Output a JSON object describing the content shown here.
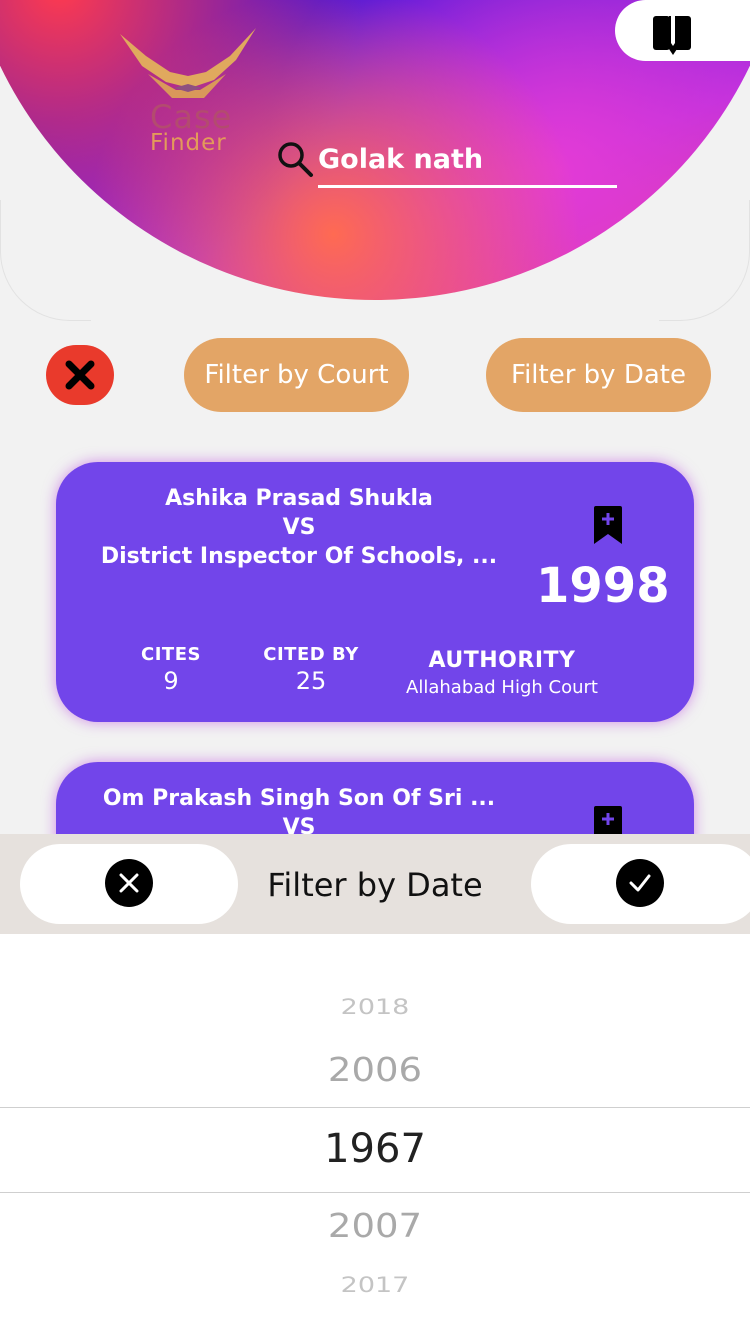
{
  "header": {
    "logo": {
      "line1": "Case",
      "line2": "Finder"
    },
    "search": {
      "query": "Golak nath",
      "icon": "search-icon"
    },
    "bookmarks_icon": "bookmarks-icon"
  },
  "filters": {
    "clear_icon": "close-icon",
    "court_label": "Filter by Court",
    "date_label": "Filter by Date"
  },
  "cards": [
    {
      "title_line1": "Ashika Prasad Shukla",
      "title_line2": "VS",
      "title_line3": "District Inspector Of Schools, ...",
      "year": "1998",
      "cites_label": "CITES",
      "cites_value": "9",
      "cited_by_label": "CITED BY",
      "cited_by_value": "25",
      "authority_label": "AUTHORITY",
      "authority_value": "Allahabad High Court"
    },
    {
      "title_line1": "Om Prakash Singh Son Of Sri ...",
      "title_line2": "VS"
    }
  ],
  "date_picker": {
    "title": "Filter by Date",
    "options": [
      "2018",
      "2006",
      "1967",
      "2007",
      "2017"
    ],
    "selected": "1967"
  },
  "colors": {
    "card": "#7245ea",
    "pill": "#e3a566",
    "clear": "#e93a2c",
    "toolbar": "#e6e1dd"
  }
}
